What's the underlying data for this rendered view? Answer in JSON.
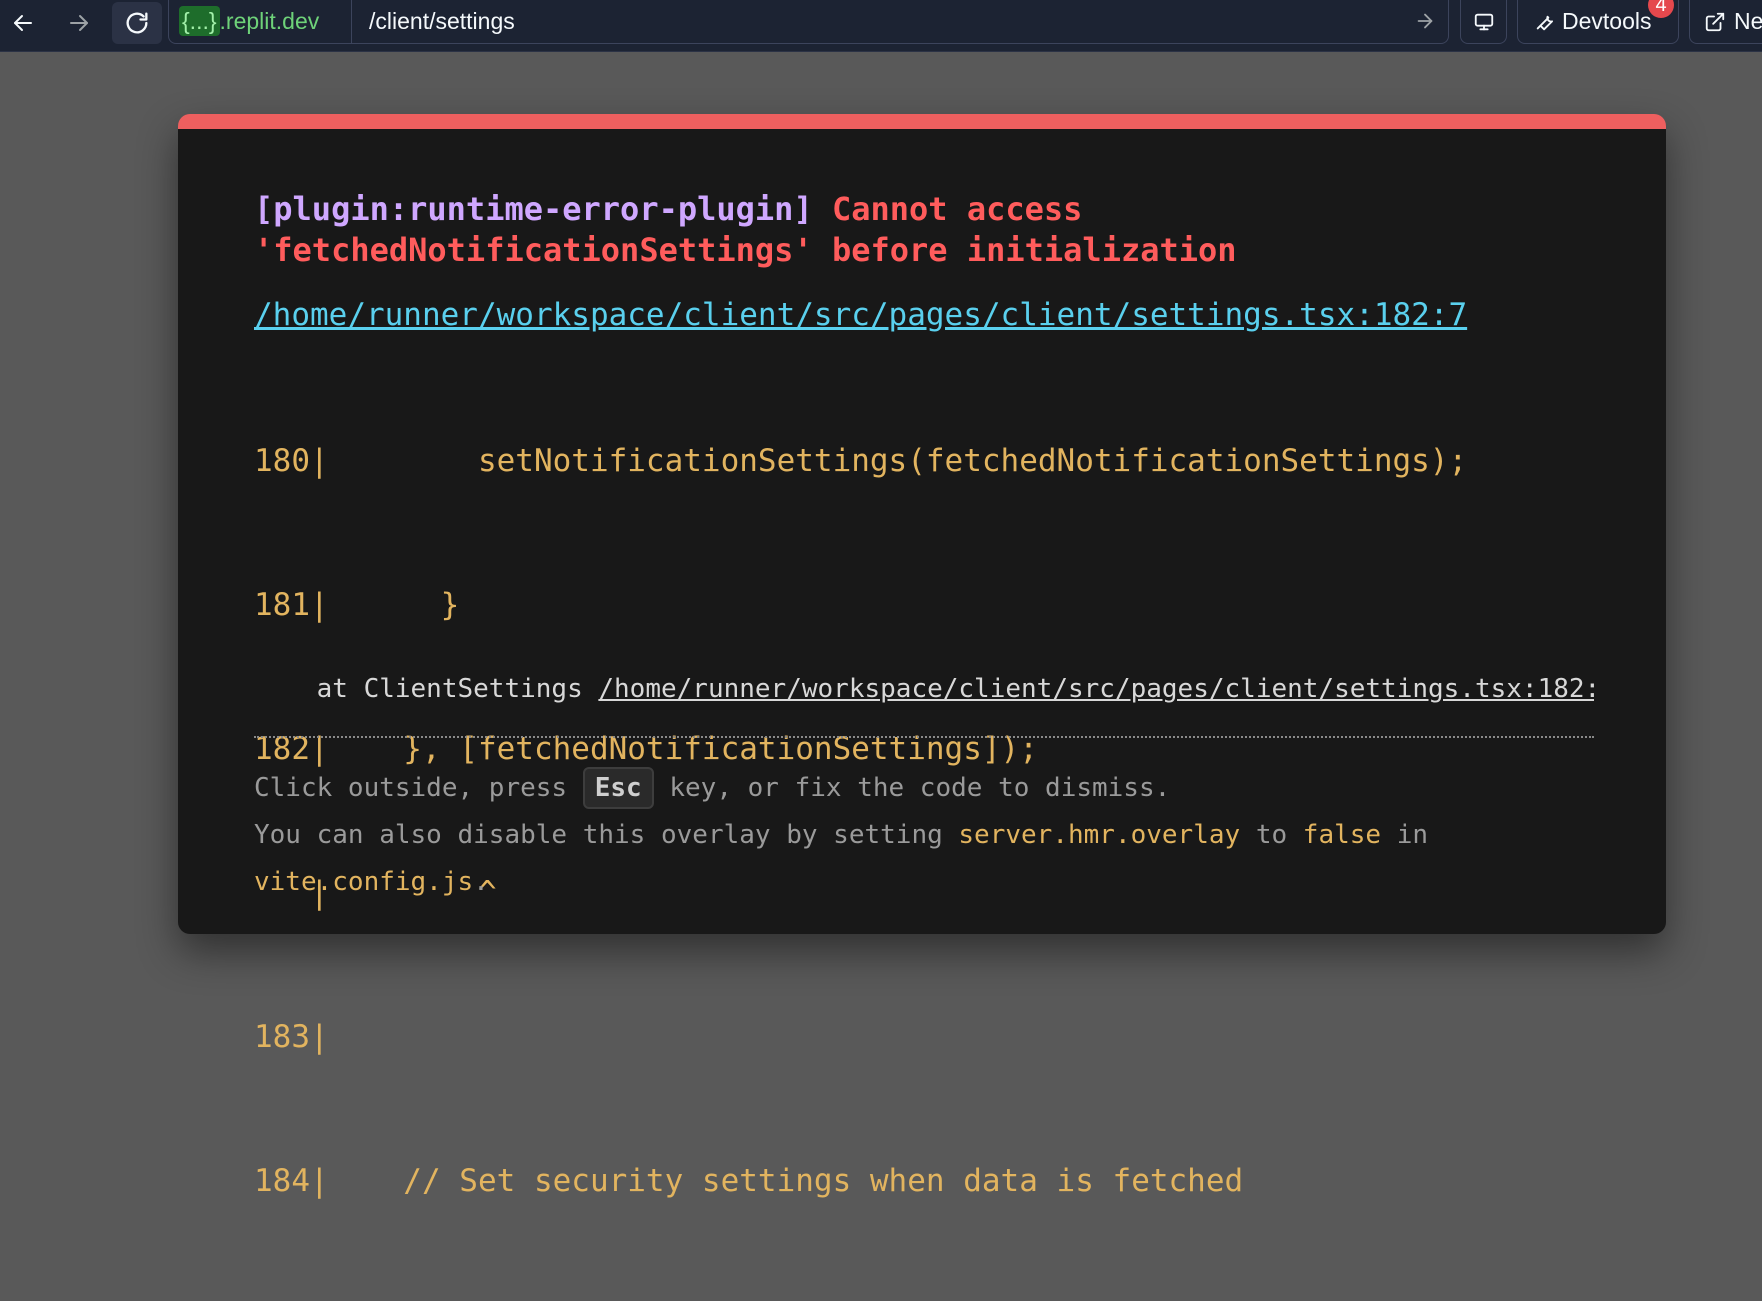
{
  "toolbar": {
    "url_domain_prefix": "{...}",
    "url_domain_suffix": ".replit.dev",
    "url_path": "/client/settings",
    "devtools_label": "Devtools",
    "devtools_badge": "4",
    "new_tab_label": "Ne",
    "icons": [
      "arrow-left-icon",
      "arrow-right-icon",
      "reload-icon",
      "go-arrow-icon",
      "monitor-icon",
      "wrench-icon",
      "external-link-icon"
    ]
  },
  "overlay": {
    "accent_color": "#ee5f5f",
    "plugin_tag": "[plugin:runtime-error-plugin]",
    "message_line_1": "Cannot access",
    "message_line_2": "'fetchedNotificationSettings' before initialization",
    "file_link": "/home/runner/workspace/client/src/pages/client/settings.tsx:182:7",
    "code_lines": [
      "180|        setNotificationSettings(fetchedNotificationSettings);",
      "181|      }",
      "182|    }, [fetchedNotificationSettings]);",
      "   |        ^",
      "183|",
      "184|    // Set security settings when data is fetched"
    ],
    "stack_prefix": "    at ClientSettings ",
    "stack_file": "/home/runner/workspace/client/src/pages/client/settings.tsx:182:",
    "tip": {
      "line1_before": "Click outside, press ",
      "key": "Esc",
      "line1_after": " key, or fix the code to dismiss.",
      "line2_a": "You can also disable this overlay by setting ",
      "line2_code1": "server.hmr.overlay",
      "line2_b": " to ",
      "line2_code2": "false",
      "line2_c": " in",
      "line3_code": "vite.config.js",
      "line3_end": "."
    }
  }
}
